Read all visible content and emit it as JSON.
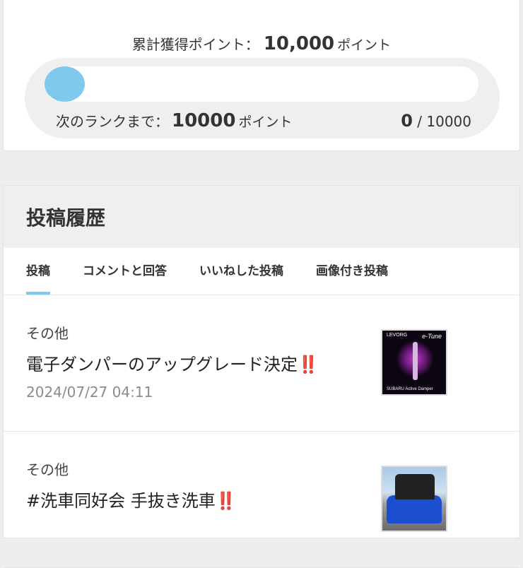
{
  "points": {
    "total_label": "累計獲得ポイント：",
    "total_value": "10,000",
    "total_unit": "ポイント",
    "progress_fraction": 0,
    "next_rank_label": "次のランクまで：",
    "next_rank_value": "10000",
    "next_rank_unit": "ポイント",
    "current": "0",
    "separator": "/",
    "max": "10000",
    "accent_color": "#7fc8ee"
  },
  "history": {
    "title": "投稿履歴",
    "tabs": [
      {
        "label": "投稿",
        "active": true
      },
      {
        "label": "コメントと回答",
        "active": false
      },
      {
        "label": "いいねした投稿",
        "active": false
      },
      {
        "label": "画像付き投稿",
        "active": false
      }
    ],
    "posts": [
      {
        "category": "その他",
        "title": "電子ダンパーのアップグレード決定",
        "emoji": "‼️",
        "date": "2024/07/27 04:11",
        "thumb_top_left": "LEVORG",
        "thumb_top_right": "e-Tune",
        "thumb_bottom": "SUBARU Active Damper"
      },
      {
        "category": "その他",
        "title": "#洗車同好会 手抜き洗車",
        "emoji": "‼️"
      }
    ]
  }
}
